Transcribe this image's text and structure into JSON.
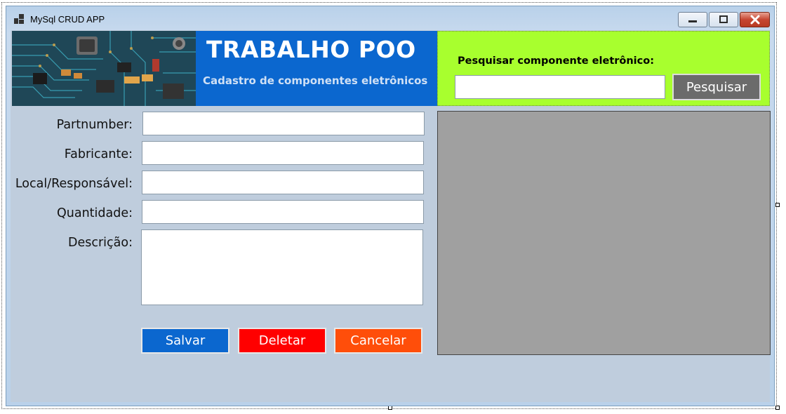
{
  "window": {
    "title": "MySql CRUD APP"
  },
  "header": {
    "title": "TRABALHO POO",
    "subtitle": "Cadastro de componentes eletrônicos",
    "image_icon": "circuit-board-image"
  },
  "search": {
    "label": "Pesquisar componente eletrônico:",
    "value": "",
    "button_label": "Pesquisar"
  },
  "form": {
    "partnumber_label": "Partnumber:",
    "fabricante_label": "Fabricante:",
    "local_label": "Local/Responsável:",
    "quantidade_label": "Quantidade:",
    "descricao_label": "Descrição:",
    "partnumber_value": "",
    "fabricante_value": "",
    "local_value": "",
    "quantidade_value": "",
    "descricao_value": ""
  },
  "actions": {
    "save_label": "Salvar",
    "delete_label": "Deletar",
    "cancel_label": "Cancelar"
  },
  "colors": {
    "header_blue": "#0b67cf",
    "search_panel": "#a8ff2e",
    "save": "#0b67cf",
    "delete": "#ff0000",
    "cancel": "#ff4e0a",
    "grid": "#a0a0a0"
  }
}
